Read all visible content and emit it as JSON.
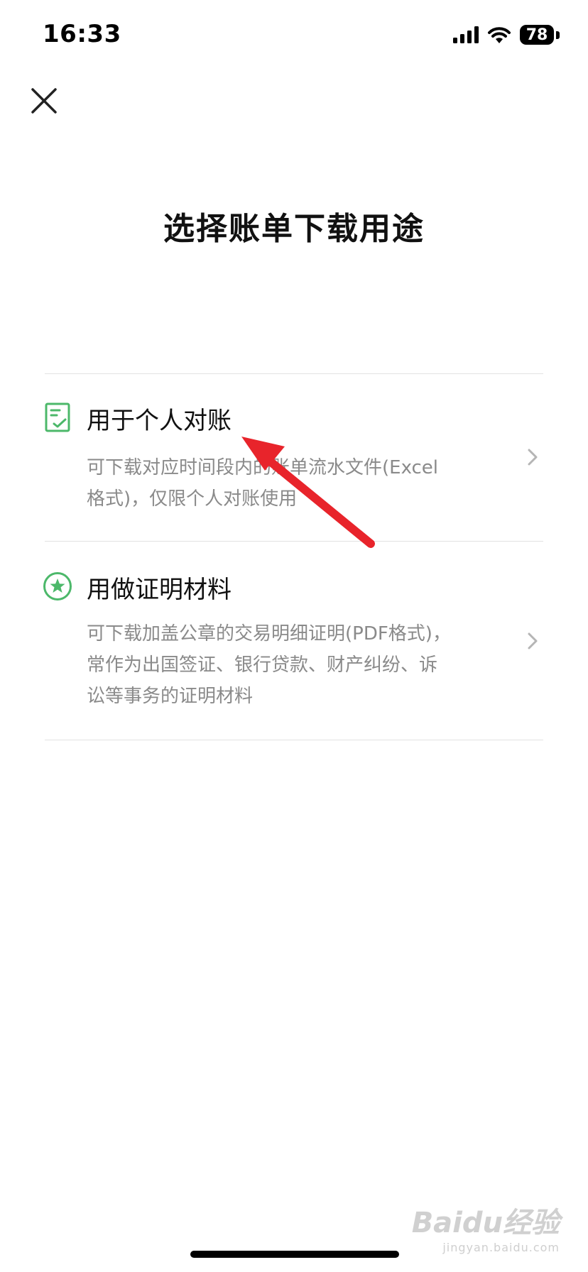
{
  "status_bar": {
    "time": "16:33",
    "battery": "78"
  },
  "page": {
    "title": "选择账单下载用途"
  },
  "options": [
    {
      "title": "用于个人对账",
      "desc_lines": [
        "可下载对应时间段内的账单流水文件(Excel",
        "格式)，仅限个人对账使用"
      ]
    },
    {
      "title": "用做证明材料",
      "desc_lines": [
        "可下载加盖公章的交易明细证明(PDF格式)，",
        "常作为出国签证、银行贷款、财产纠纷、诉",
        "讼等事务的证明材料"
      ]
    }
  ],
  "colors": {
    "accent_green": "#4cb86a",
    "annotation_red": "#e8242b"
  },
  "watermark": {
    "logo": "Baidu经验",
    "sub": "jingyan.baidu.com"
  }
}
